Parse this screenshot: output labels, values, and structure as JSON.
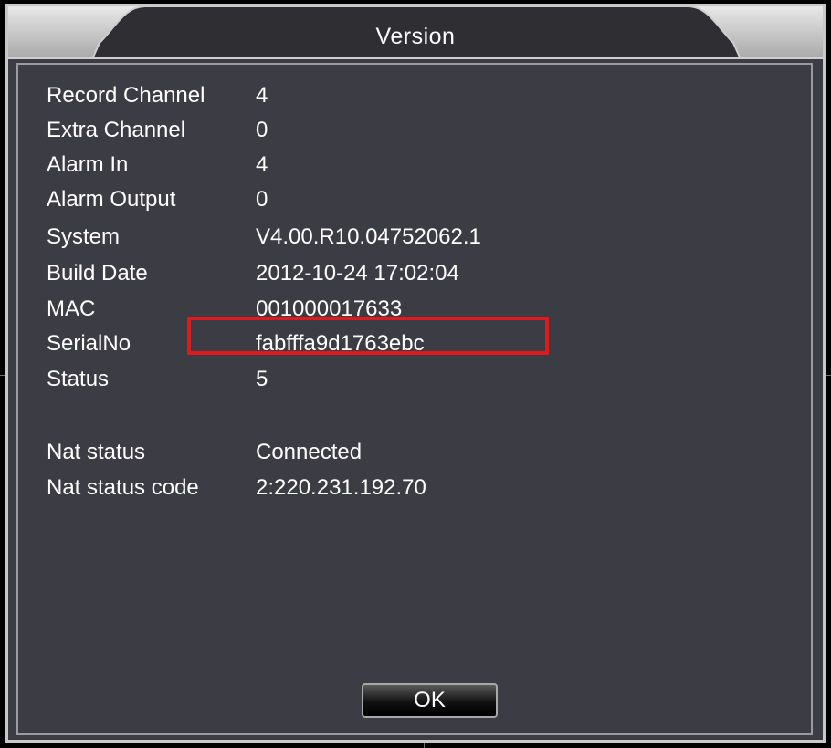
{
  "dialog": {
    "title": "Version"
  },
  "info": {
    "rows": [
      {
        "label": "Record Channel",
        "value": "4"
      },
      {
        "label": "Extra Channel",
        "value": "0"
      },
      {
        "label": "Alarm In",
        "value": "4"
      },
      {
        "label": "Alarm Output",
        "value": "0"
      },
      {
        "label": "System",
        "value": "V4.00.R10.04752062.1"
      },
      {
        "label": "Build Date",
        "value": "2012-10-24 17:02:04"
      },
      {
        "label": "MAC",
        "value": "001000017633"
      },
      {
        "label": "SerialNo",
        "value": "fabfffa9d1763ebc"
      },
      {
        "label": "Status",
        "value": "5"
      },
      {
        "label": "Nat status",
        "value": "Connected"
      },
      {
        "label": "Nat status code",
        "value": "2:220.231.192.70"
      }
    ]
  },
  "buttons": {
    "ok_label": "OK"
  },
  "colors": {
    "background": "#3c3c44",
    "highlight": "#e0191c",
    "text": "#ffffff"
  }
}
